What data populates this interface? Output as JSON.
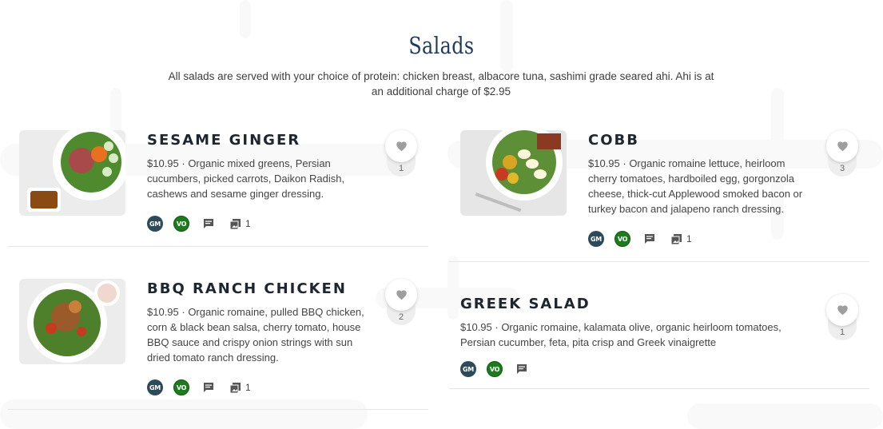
{
  "section": {
    "title": "Salads",
    "subtitle": "All salads are served with your choice of protein: chicken breast, albacore tuna, sashimi grade seared ahi. Ahi is at an additional charge of $2.95"
  },
  "colors": {
    "title": "#1f3a5f",
    "badge_gm": "#2c4a5a",
    "badge_vo": "#1d7a1d",
    "heart": "#9e9e9e"
  },
  "items": [
    {
      "name": "SESAME GINGER",
      "description": "$10.95 · Organic mixed greens, Persian cucumbers, picked carrots, Daikon Radish, cashews and sesame ginger dressing.",
      "badges": [
        "GM",
        "VO"
      ],
      "photo_count": "1",
      "likes": "1",
      "icons": [
        "comment-icon",
        "photo-icon",
        "heart-icon"
      ]
    },
    {
      "name": "COBB",
      "description": "$10.95 · Organic romaine lettuce, heirloom cherry tomatoes, hardboiled egg, gorgonzola cheese, thick-cut Applewood smoked bacon or turkey bacon and jalapeno ranch dressing.",
      "badges": [
        "GM",
        "VO"
      ],
      "photo_count": "1",
      "likes": "3",
      "icons": [
        "comment-icon",
        "photo-icon",
        "heart-icon"
      ]
    },
    {
      "name": "BBQ RANCH CHICKEN",
      "description": "$10.95 · Organic romaine, pulled BBQ chicken, corn & black bean salsa, cherry tomato, house BBQ sauce and crispy onion strings with sun dried tomato ranch dressing.",
      "badges": [
        "GM",
        "VO"
      ],
      "photo_count": "1",
      "likes": "2",
      "icons": [
        "comment-icon",
        "photo-icon",
        "heart-icon"
      ]
    },
    {
      "name": "GREEK SALAD",
      "description": "$10.95 · Organic romaine, kalamata olive, organic heirloom tomatoes, Persian cucumber, feta, pita crisp and Greek vinaigrette",
      "badges": [
        "GM",
        "VO"
      ],
      "likes": "1",
      "icons": [
        "comment-icon",
        "heart-icon"
      ]
    }
  ]
}
